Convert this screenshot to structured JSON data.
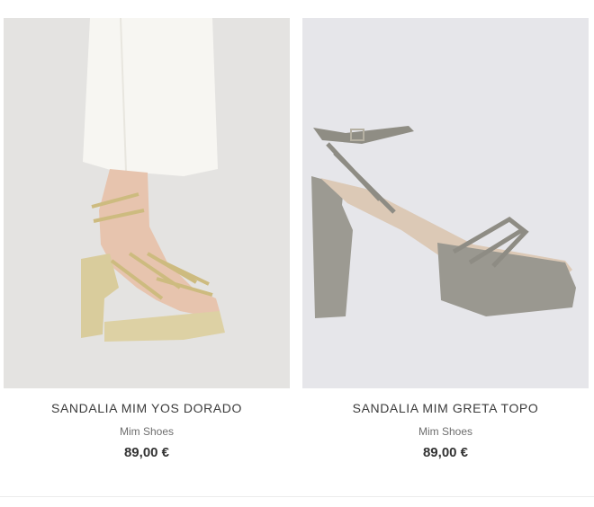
{
  "products": [
    {
      "name": "SANDALIA MIM YOS DORADO",
      "brand": "Mim Shoes",
      "price": "89,00 €",
      "image_icon": "gold-platform-sandal-on-foot",
      "background_color": "#e4e3e1"
    },
    {
      "name": "SANDALIA MIM GRETA TOPO",
      "brand": "Mim Shoes",
      "price": "89,00 €",
      "image_icon": "taupe-platform-sandal",
      "background_color": "#e6e6ea"
    }
  ]
}
